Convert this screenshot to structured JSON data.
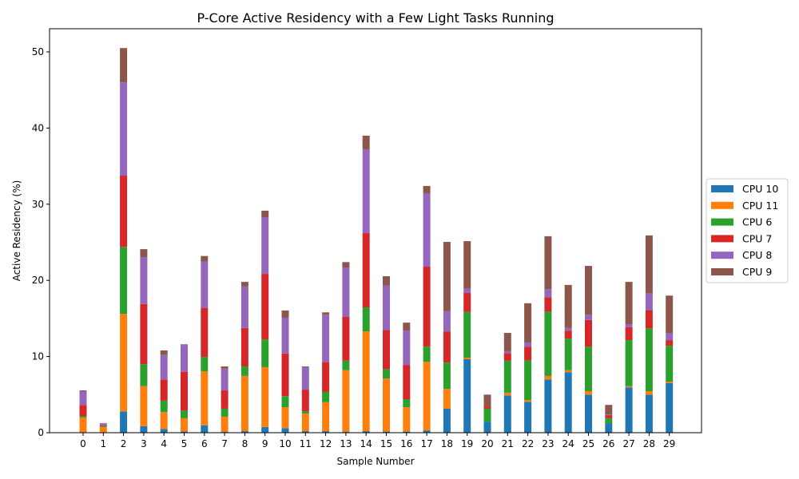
{
  "chart_data": {
    "type": "bar",
    "stacked": true,
    "title": "P-Core Active Residency with a Few Light Tasks Running",
    "xlabel": "Sample Number",
    "ylabel": "Active Residency (%)",
    "ylim": [
      0,
      53
    ],
    "yticks": [
      0,
      10,
      20,
      30,
      40,
      50
    ],
    "grid": false,
    "legend_position": "center-right-outside",
    "categories": [
      "0",
      "1",
      "2",
      "3",
      "4",
      "5",
      "6",
      "7",
      "8",
      "9",
      "10",
      "11",
      "12",
      "13",
      "14",
      "15",
      "16",
      "17",
      "18",
      "19",
      "20",
      "21",
      "22",
      "23",
      "24",
      "25",
      "26",
      "27",
      "28",
      "29"
    ],
    "series": [
      {
        "name": "CPU 10",
        "color": "#1f77b4",
        "values": [
          0,
          0,
          2.8,
          0.85,
          0.5,
          0.15,
          0.95,
          0.1,
          0.2,
          0.75,
          0.6,
          0.2,
          0.2,
          0.1,
          0.2,
          0.15,
          0.15,
          0.3,
          3.15,
          9.65,
          1.45,
          4.9,
          4.05,
          7.0,
          7.95,
          5.0,
          1.25,
          5.95,
          5.0,
          6.5
        ]
      },
      {
        "name": "CPU 11",
        "color": "#ff7f0e",
        "values": [
          2.0,
          0.75,
          12.8,
          5.25,
          2.2,
          1.75,
          7.1,
          2.0,
          7.25,
          7.85,
          2.75,
          2.3,
          3.8,
          8.1,
          13.1,
          6.95,
          3.2,
          9.0,
          2.6,
          0.2,
          0,
          0.35,
          0.25,
          0.45,
          0.25,
          0.45,
          0,
          0.15,
          0.45,
          0.2
        ]
      },
      {
        "name": "CPU 6",
        "color": "#2ca02c",
        "values": [
          0.2,
          0.1,
          8.8,
          2.9,
          1.5,
          1.0,
          1.9,
          1.05,
          1.25,
          3.65,
          1.45,
          0.3,
          1.35,
          1.25,
          3.15,
          1.25,
          1.05,
          2.0,
          3.45,
          6.0,
          1.7,
          4.2,
          5.2,
          8.45,
          4.15,
          5.85,
          0.65,
          6.05,
          8.25,
          4.7
        ]
      },
      {
        "name": "CPU 7",
        "color": "#d62728",
        "values": [
          1.45,
          0.1,
          9.35,
          7.9,
          2.8,
          5.1,
          6.4,
          2.4,
          5.05,
          8.6,
          5.6,
          2.85,
          3.95,
          5.75,
          9.75,
          5.15,
          4.5,
          10.5,
          4.1,
          2.5,
          0.3,
          1.0,
          1.8,
          1.9,
          1.05,
          3.5,
          0.4,
          1.7,
          2.4,
          0.75
        ]
      },
      {
        "name": "CPU 8",
        "color": "#9467bd",
        "values": [
          1.8,
          0.3,
          12.25,
          6.15,
          3.2,
          3.5,
          6.1,
          2.85,
          5.45,
          7.45,
          4.7,
          2.95,
          6.2,
          6.5,
          11.0,
          5.8,
          4.5,
          9.65,
          2.65,
          0.55,
          0,
          0.25,
          0.55,
          1.05,
          0.35,
          0.7,
          0.1,
          0.4,
          2.2,
          0.95
        ]
      },
      {
        "name": "CPU 9",
        "color": "#8c564b",
        "values": [
          0.1,
          0,
          4.5,
          1.05,
          0.6,
          0.1,
          0.75,
          0.3,
          0.6,
          0.85,
          0.95,
          0.1,
          0.3,
          0.7,
          1.8,
          1.25,
          1.05,
          0.95,
          9.1,
          6.25,
          1.55,
          2.4,
          5.15,
          6.95,
          5.65,
          6.4,
          1.25,
          5.55,
          7.6,
          4.9
        ]
      }
    ]
  }
}
